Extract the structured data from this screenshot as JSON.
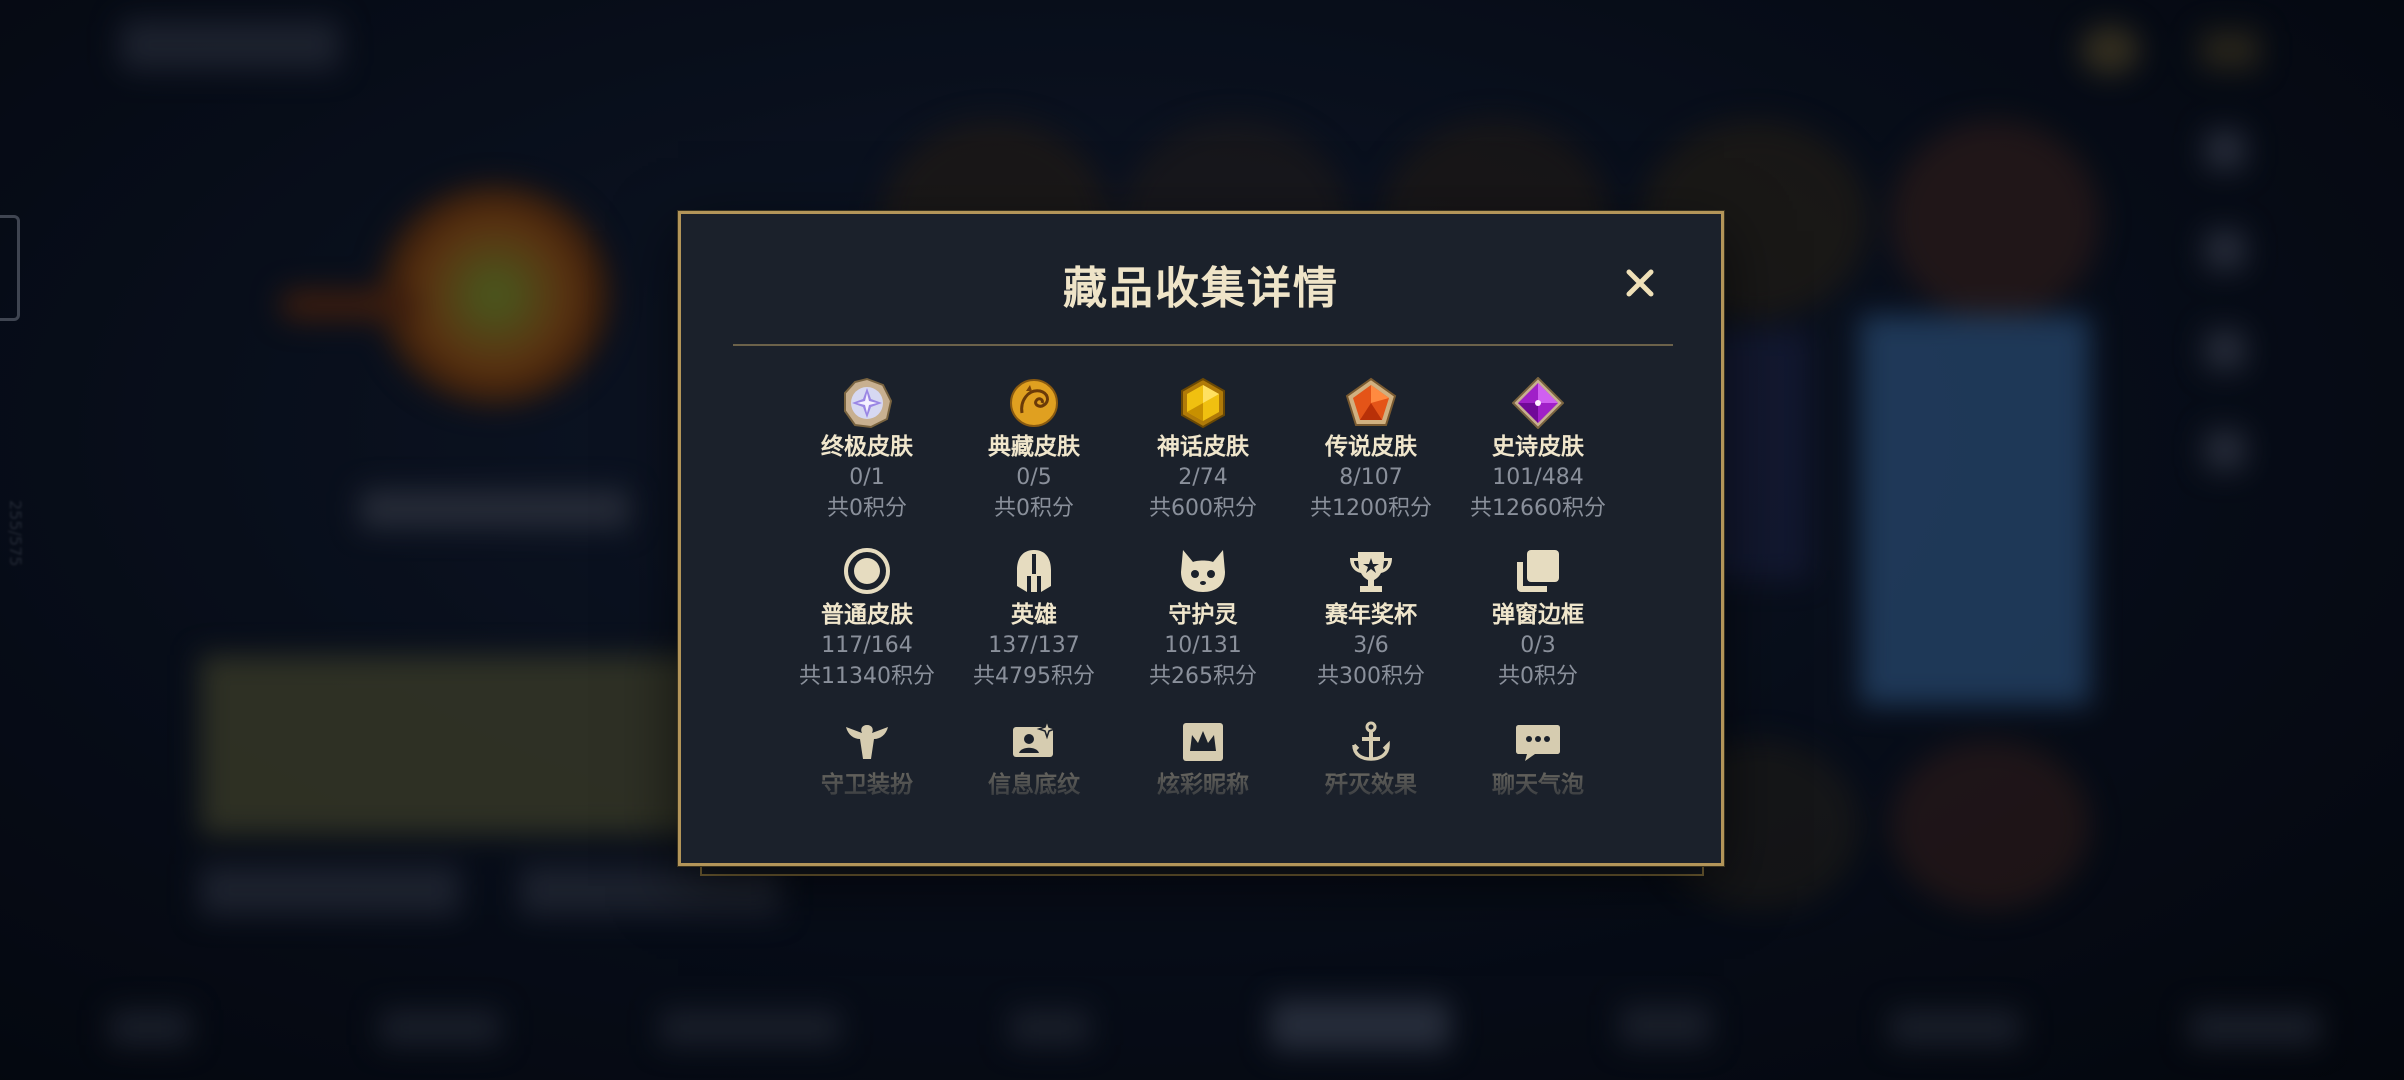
{
  "modal": {
    "title": "藏品收集详情",
    "close_icon": "close-x-icon"
  },
  "background": {
    "side_text": "255/575"
  },
  "colors": {
    "accent_gold": "#b39559",
    "title_text": "#efe4c8",
    "muted_text": "#8a909b",
    "panel_bg": "#1b212b"
  },
  "items": [
    {
      "name": "终极皮肤",
      "count": "0/1",
      "points": "共0积分",
      "icon": "ultimate-skin-icon"
    },
    {
      "name": "典藏皮肤",
      "count": "0/5",
      "points": "共0积分",
      "icon": "collection-skin-icon"
    },
    {
      "name": "神话皮肤",
      "count": "2/74",
      "points": "共600积分",
      "icon": "mythic-skin-icon"
    },
    {
      "name": "传说皮肤",
      "count": "8/107",
      "points": "共1200积分",
      "icon": "legendary-skin-icon"
    },
    {
      "name": "史诗皮肤",
      "count": "101/484",
      "points": "共12660积分",
      "icon": "epic-skin-icon"
    },
    {
      "name": "普通皮肤",
      "count": "117/164",
      "points": "共11340积分",
      "icon": "standard-skin-icon"
    },
    {
      "name": "英雄",
      "count": "137/137",
      "points": "共4795积分",
      "icon": "champion-helmet-icon"
    },
    {
      "name": "守护灵",
      "count": "10/131",
      "points": "共265积分",
      "icon": "guardian-pet-icon"
    },
    {
      "name": "赛年奖杯",
      "count": "3/6",
      "points": "共300积分",
      "icon": "trophy-icon"
    },
    {
      "name": "弹窗边框",
      "count": "0/3",
      "points": "共0积分",
      "icon": "popup-frame-icon"
    },
    {
      "name": "守卫装扮",
      "icon": "ward-skin-icon"
    },
    {
      "name": "信息底纹",
      "icon": "info-card-icon"
    },
    {
      "name": "炫彩昵称",
      "icon": "fancy-nickname-icon"
    },
    {
      "name": "歼灭效果",
      "icon": "elimination-effect-icon"
    },
    {
      "name": "聊天气泡",
      "icon": "chat-bubble-icon"
    }
  ]
}
